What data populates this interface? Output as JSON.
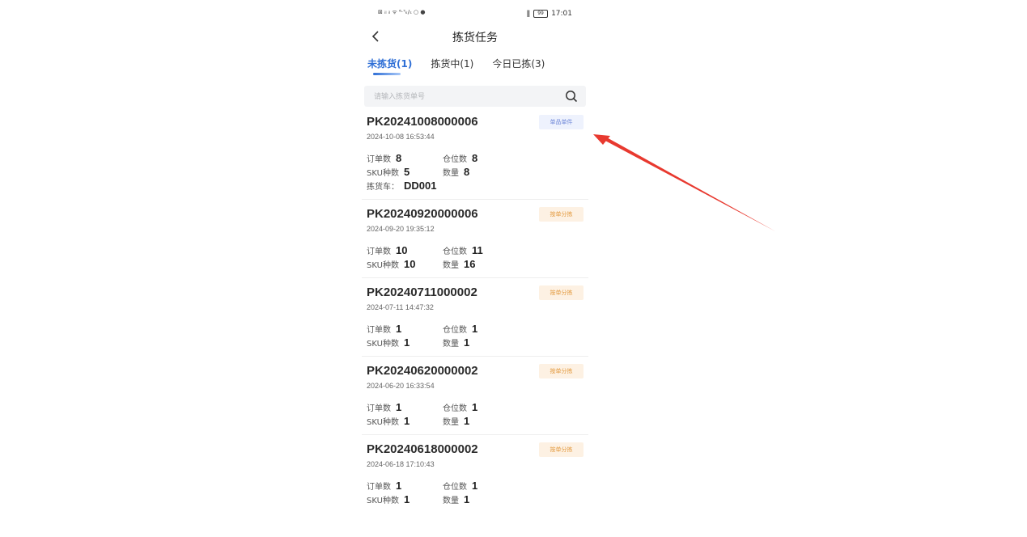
{
  "status_bar": {
    "left_text": "⊠ ᵢₗ ᵢₗ ᯤ ⁶·⁷ₖ/ₛ ○ ●",
    "time": "17:01",
    "battery": "99"
  },
  "header": {
    "title": "拣货任务"
  },
  "tabs": [
    {
      "label": "未拣货(1)"
    },
    {
      "label": "拣货中(1)"
    },
    {
      "label": "今日已拣(3)"
    }
  ],
  "search": {
    "placeholder": "请输入拣货单号",
    "value": ""
  },
  "labels": {
    "orders": "订单数",
    "locations": "仓位数",
    "sku": "SKU种数",
    "qty": "数量",
    "cart": "拣货车："
  },
  "tasks": [
    {
      "code": "PK20241008000006",
      "datetime": "2024-10-08 16:53:44",
      "tag": "单品单件",
      "tag_color": "blue",
      "orders": "8",
      "locations": "8",
      "sku": "5",
      "qty": "8",
      "cart": "DD001"
    },
    {
      "code": "PK20240920000006",
      "datetime": "2024-09-20 19:35:12",
      "tag": "按单分拣",
      "tag_color": "orange",
      "orders": "10",
      "locations": "11",
      "sku": "10",
      "qty": "16"
    },
    {
      "code": "PK20240711000002",
      "datetime": "2024-07-11 14:47:32",
      "tag": "按单分拣",
      "tag_color": "orange",
      "orders": "1",
      "locations": "1",
      "sku": "1",
      "qty": "1"
    },
    {
      "code": "PK20240620000002",
      "datetime": "2024-06-20 16:33:54",
      "tag": "按单分拣",
      "tag_color": "orange",
      "orders": "1",
      "locations": "1",
      "sku": "1",
      "qty": "1"
    },
    {
      "code": "PK20240618000002",
      "datetime": "2024-06-18 17:10:43",
      "tag": "按单分拣",
      "tag_color": "orange",
      "orders": "1",
      "locations": "1",
      "sku": "1",
      "qty": "1"
    }
  ],
  "annotation": {
    "arrow_color": "#e8392f"
  }
}
